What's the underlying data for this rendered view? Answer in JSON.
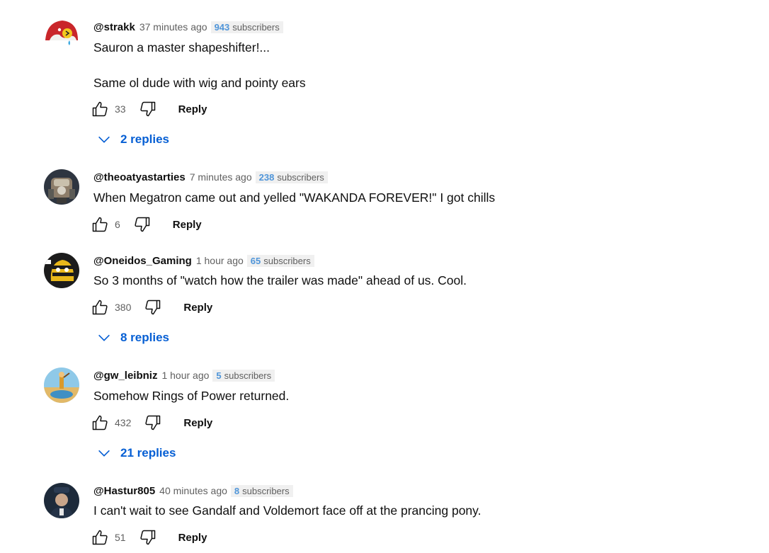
{
  "comments": [
    {
      "author": "@strakk",
      "time": "37 minutes ago",
      "subs_count": "943",
      "subs_word": "subscribers",
      "text_lines": [
        "Sauron a master shapeshifter!...",
        "Same ol dude with wig and pointy ears"
      ],
      "likes": "33",
      "reply_label": "Reply",
      "replies_label": "2 replies",
      "avatar_icon": "angry-bird-avatar"
    },
    {
      "author": "@theoatyastarties",
      "time": "7 minutes ago",
      "subs_count": "238",
      "subs_word": "subscribers",
      "text_lines": [
        "When Megatron came out and yelled \"WAKANDA FOREVER!\" I got chills"
      ],
      "likes": "6",
      "reply_label": "Reply",
      "avatar_icon": "robot-avatar"
    },
    {
      "author": "@Oneidos_Gaming",
      "time": "1 hour ago",
      "subs_count": "65",
      "subs_word": "subscribers",
      "text_lines": [
        "So 3 months of \"watch how the trailer was made\" ahead of us. Cool."
      ],
      "likes": "380",
      "reply_label": "Reply",
      "replies_label": "8 replies",
      "avatar_icon": "striped-helmet-avatar"
    },
    {
      "author": "@gw_leibniz",
      "time": "1 hour ago",
      "subs_count": "5",
      "subs_word": "subscribers",
      "text_lines": [
        "Somehow Rings of Power returned."
      ],
      "likes": "432",
      "reply_label": "Reply",
      "replies_label": "21 replies",
      "avatar_icon": "desert-figure-avatar"
    },
    {
      "author": "@Hastur805",
      "time": "40 minutes ago",
      "subs_count": "8",
      "subs_word": "subscribers",
      "text_lines": [
        "I can't wait to see Gandalf and Voldemort face off at the prancing pony."
      ],
      "likes": "51",
      "reply_label": "Reply",
      "avatar_icon": "captain-portrait-avatar"
    }
  ],
  "icons": {
    "like": "thumbs-up-icon",
    "dislike": "thumbs-down-icon",
    "expand": "chevron-down-icon"
  },
  "colors": {
    "link_blue": "#065fd4",
    "subs_number": "#4f95d9",
    "meta_gray": "#606060"
  }
}
